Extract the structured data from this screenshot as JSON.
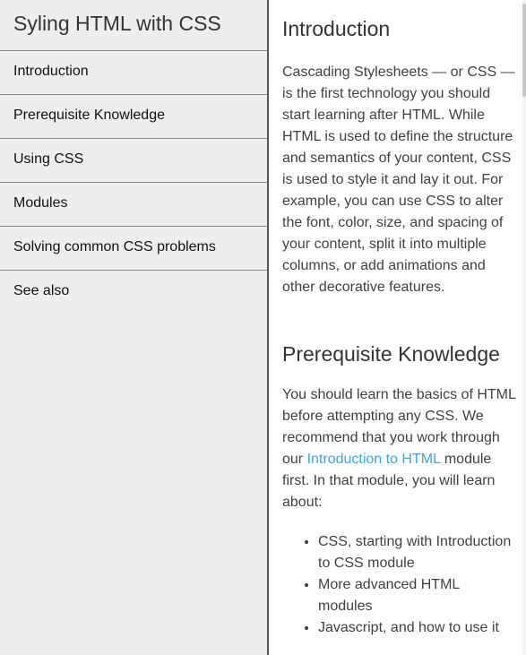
{
  "sidebar": {
    "title": "Syling HTML with CSS",
    "items": [
      {
        "label": "Introduction"
      },
      {
        "label": "Prerequisite Knowledge"
      },
      {
        "label": "Using CSS"
      },
      {
        "label": "Modules"
      },
      {
        "label": "Solving common CSS problems"
      },
      {
        "label": "See also"
      }
    ]
  },
  "main": {
    "intro": {
      "heading": "Introduction",
      "paragraph": "Cascading Stylesheets — or CSS — is the first technology you should start learning after HTML. While HTML is used to define the structure and semantics of your content, CSS is used to style it and lay it out. For example, you can use CSS to alter the font, color, size, and spacing of your content, split it into multiple columns, or add animations and other decorative features."
    },
    "prereq": {
      "heading": "Prerequisite Knowledge",
      "text_before": "You should learn the basics of HTML before attempting any CSS. We recommend that you work through our ",
      "link": "Introduction to HTML",
      "text_after": " module first. In that module, you will learn about:",
      "topics": [
        "CSS, starting with Introduction to CSS module",
        "More advanced HTML modules",
        "Javascript, and how to use it"
      ]
    }
  },
  "colors": {
    "sidebar_bg": "#eeeeee",
    "link": "#3fa9d8",
    "divider": "#8a8a8a"
  }
}
